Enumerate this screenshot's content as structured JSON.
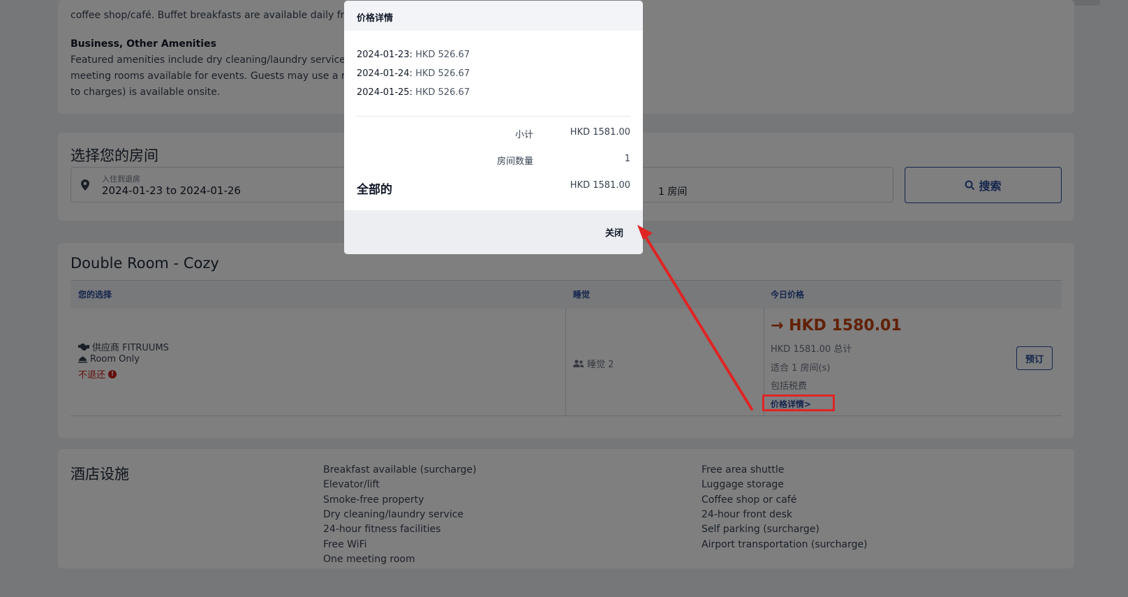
{
  "description_card": {
    "line_top": "coffee shop/café. Buffet breakfasts are available daily from",
    "section_title": "Business, Other Amenities",
    "lines": [
      "Featured amenities include dry cleaning/laundry services,",
      "meeting rooms available for events. Guests may use a rou",
      "to charges) is available onsite."
    ]
  },
  "search": {
    "title": "选择您的房间",
    "date_label": "入住到退房",
    "date_value": "2024-01-23 to 2024-01-26",
    "rooms_value": "1  房间",
    "button_label": "搜索"
  },
  "room": {
    "title": "Double Room - Cozy",
    "headers": [
      "您的选择",
      "睡觉",
      "今日价格"
    ],
    "supplier": "供应商 FITRUUMS",
    "meal": "Room Only",
    "refund": "不退还",
    "sleeps": "睡觉 2",
    "price_main": "→ HKD 1580.01",
    "price_total": "HKD 1581.00 总计",
    "fits": "适合 1 房间(s)",
    "tax": "包括税费",
    "details_link": "价格详情>",
    "book_label": "预订"
  },
  "facilities": {
    "title": "酒店设施",
    "col1": [
      "Breakfast available (surcharge)",
      "Elevator/lift",
      "Smoke-free property",
      "Dry cleaning/laundry service",
      "24-hour fitness facilities",
      "Free WiFi",
      "One meeting room"
    ],
    "col2": [
      "Free area shuttle",
      "Luggage storage",
      "Coffee shop or café",
      "24-hour front desk",
      "Self parking (surcharge)",
      "Airport transportation (surcharge)"
    ]
  },
  "modal": {
    "title": "价格详情",
    "nights": [
      {
        "date": "2024-01-23:",
        "amount": "HKD 526.67"
      },
      {
        "date": "2024-01-24:",
        "amount": "HKD 526.67"
      },
      {
        "date": "2024-01-25:",
        "amount": "HKD 526.67"
      }
    ],
    "subtotal_label": "小计",
    "subtotal_value": "HKD 1581.00",
    "rooms_label": "房间数量",
    "rooms_value": "1",
    "total_label": "全部的",
    "total_value": "HKD 1581.00",
    "close_label": "关闭"
  },
  "colors": {
    "accent": "#2b4b9b",
    "price": "#c2410c",
    "danger": "#c81e1e",
    "annotation": "#e02424"
  }
}
